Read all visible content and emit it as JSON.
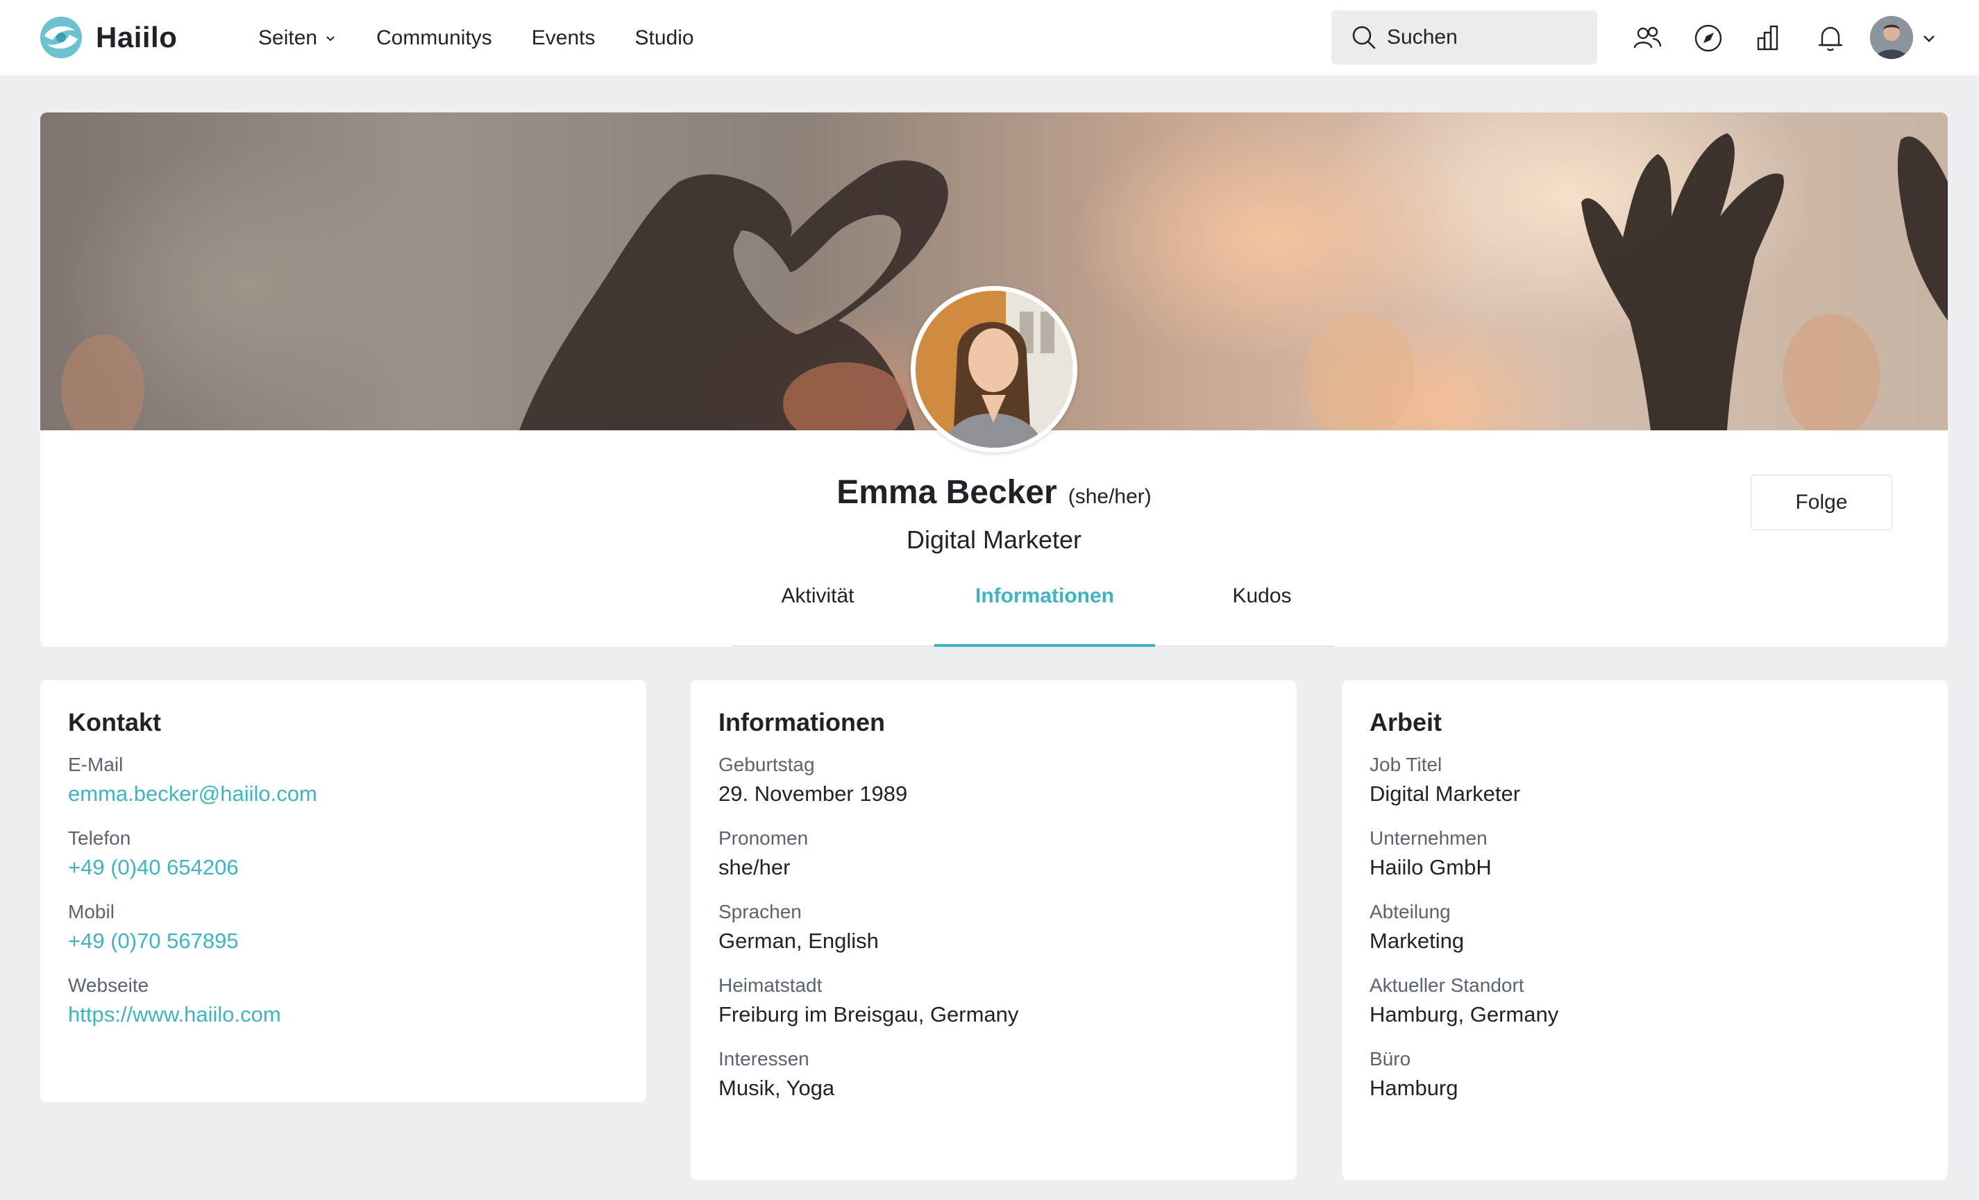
{
  "app": {
    "name": "Haiilo",
    "accent_color": "#3fb3c2"
  },
  "nav": {
    "items": [
      {
        "label": "Seiten",
        "has_dropdown": true
      },
      {
        "label": "Communitys"
      },
      {
        "label": "Events"
      },
      {
        "label": "Studio"
      }
    ]
  },
  "search": {
    "label": "Suchen"
  },
  "toolbar_icons": [
    "people-icon",
    "compass-icon",
    "chart-icon",
    "bell-icon"
  ],
  "profile": {
    "name": "Emma Becker",
    "pronouns": "(she/her)",
    "job_title": "Digital Marketer",
    "follow_label": "Folge",
    "tabs": [
      {
        "label": "Aktivität"
      },
      {
        "label": "Informationen",
        "active": true
      },
      {
        "label": "Kudos"
      }
    ]
  },
  "contact": {
    "title": "Kontakt",
    "fields": [
      {
        "label": "E-Mail",
        "value": "emma.becker@haiilo.com"
      },
      {
        "label": "Telefon",
        "value": "+49 (0)40 654206"
      },
      {
        "label": "Mobil",
        "value": "+49 (0)70 567895"
      },
      {
        "label": "Webseite",
        "value": "https://www.haiilo.com"
      }
    ]
  },
  "info": {
    "title": "Informationen",
    "fields": [
      {
        "label": "Geburtstag",
        "value": "29. November 1989"
      },
      {
        "label": "Pronomen",
        "value": "she/her"
      },
      {
        "label": "Sprachen",
        "value": "German, English"
      },
      {
        "label": "Heimatstadt",
        "value": "Freiburg im Breisgau, Germany"
      },
      {
        "label": "Interessen",
        "value": "Musik, Yoga"
      }
    ]
  },
  "work": {
    "title": "Arbeit",
    "fields": [
      {
        "label": "Job Titel",
        "value": "Digital Marketer"
      },
      {
        "label": "Unternehmen",
        "value": "Haiilo GmbH"
      },
      {
        "label": "Abteilung",
        "value": "Marketing"
      },
      {
        "label": "Aktueller Standort",
        "value": "Hamburg, Germany"
      },
      {
        "label": "Büro",
        "value": "Hamburg"
      }
    ]
  }
}
